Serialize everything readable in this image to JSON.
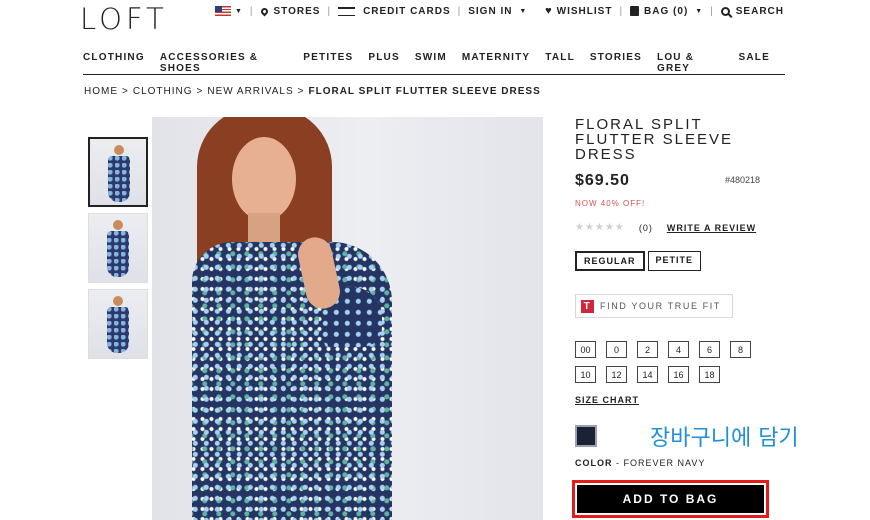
{
  "header": {
    "logo": "LOFT",
    "stores": "STORES",
    "credit_cards": "CREDIT CARDS",
    "sign_in": "SIGN IN",
    "wishlist": "WISHLIST",
    "bag": "BAG (0)",
    "search": "SEARCH"
  },
  "nav": [
    "CLOTHING",
    "ACCESSORIES & SHOES",
    "PETITES",
    "PLUS",
    "SWIM",
    "MATERNITY",
    "TALL",
    "STORIES",
    "LOU & GREY",
    "SALE"
  ],
  "breadcrumb": {
    "items": [
      "HOME",
      "CLOTHING",
      "NEW ARRIVALS"
    ],
    "current": "FLORAL SPLIT FLUTTER SLEEVE DRESS",
    "separator": ">"
  },
  "product": {
    "title": "FLORAL SPLIT FLUTTER SLEEVE DRESS",
    "price": "$69.50",
    "sku": "#480218",
    "promo": "NOW 40% OFF!",
    "stars": "★★★★★",
    "review_count": "(0)",
    "write_review": "WRITE A REVIEW",
    "fit_options": [
      "REGULAR",
      "PETITE"
    ],
    "selected_fit": "REGULAR",
    "true_fit_label": "FIND YOUR TRUE FIT",
    "true_fit_logo": "T",
    "sizes": [
      "00",
      "0",
      "2",
      "4",
      "6",
      "8",
      "10",
      "12",
      "14",
      "16",
      "18"
    ],
    "size_chart": "SIZE CHART",
    "annotation": "장바구니에 담기",
    "color_label": "COLOR",
    "color_name": "FOREVER NAVY",
    "color_sep": " - ",
    "add_to_bag": "ADD TO BAG"
  },
  "colors": {
    "accent_red": "#e31b1b",
    "promo_red": "#d9534f",
    "annotation_blue": "#1e8fd8",
    "swatch": "#1c2236"
  }
}
